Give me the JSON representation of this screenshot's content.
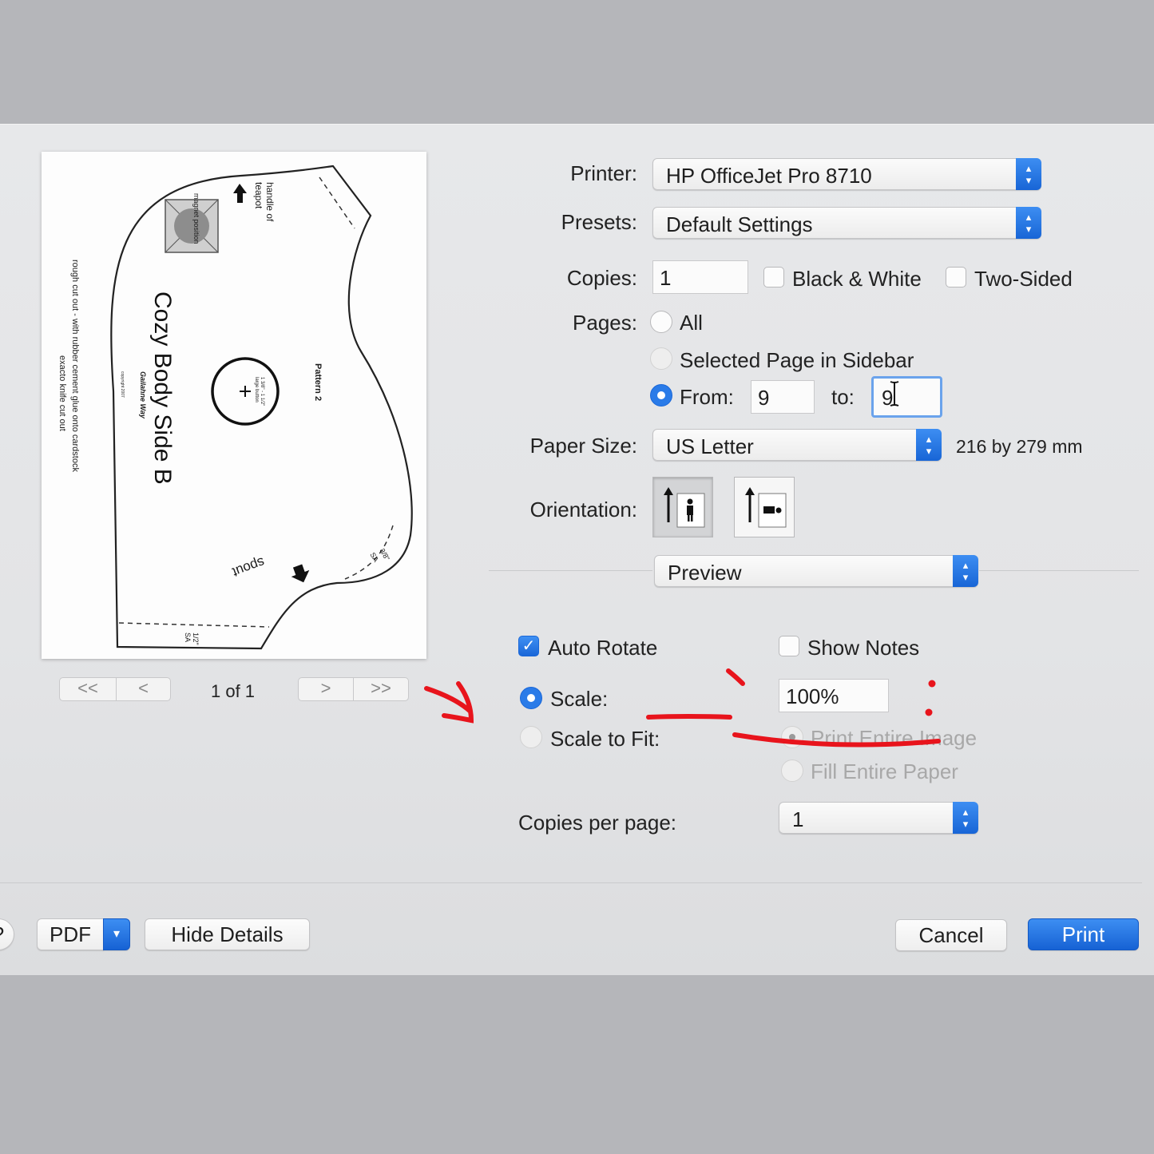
{
  "dialog": {
    "printer": {
      "label": "Printer:",
      "value": "HP OfficeJet Pro 8710"
    },
    "presets": {
      "label": "Presets:",
      "value": "Default Settings"
    },
    "copies": {
      "label": "Copies:",
      "value": "1",
      "black_white": "Black & White",
      "two_sided": "Two-Sided"
    },
    "pages": {
      "label": "Pages:",
      "all": "All",
      "selected": "Selected Page in Sidebar",
      "from_label": "From:",
      "from_value": "9",
      "to_label": "to:",
      "to_value": "9"
    },
    "paper_size": {
      "label": "Paper Size:",
      "value": "US Letter",
      "dims": "216 by 279 mm"
    },
    "orientation": {
      "label": "Orientation:"
    },
    "app_menu": {
      "value": "Preview"
    },
    "auto_rotate": "Auto Rotate",
    "show_notes": "Show Notes",
    "scale": {
      "label": "Scale:",
      "value": "100%"
    },
    "scale_to_fit": {
      "label": "Scale to Fit:",
      "print_entire": "Print Entire Image",
      "fill_entire": "Fill Entire Paper"
    },
    "copies_per_page": {
      "label": "Copies per page:",
      "value": "1"
    },
    "nav": {
      "page_indicator": "1 of 1",
      "first": "<<",
      "prev": "<",
      "next": ">",
      "last": ">>"
    },
    "footer": {
      "help": "?",
      "pdf": "PDF",
      "hide_details": "Hide Details",
      "cancel": "Cancel",
      "print": "Print"
    }
  },
  "preview_page": {
    "title": "Cozy Body Side B",
    "pattern": "Pattern 2",
    "handle": "handle of",
    "teapot": "teapot",
    "magnet": "magnet position",
    "spout": "spout",
    "button": "1 3/8\" - 1 1/2\"",
    "button2": "large button",
    "sa_left": "1/2\"",
    "sa_left2": "SA",
    "sa_right": "3/8\"",
    "sa_right2": "SA",
    "side_note1": "rough cut out - with rubber cement glue onto cardstock",
    "side_note2": "exacto knife cut out",
    "logo": "Gailahne Way",
    "copyright": "copyright 2007"
  },
  "colors": {
    "accent": "#1a67d8",
    "annotation": "#e8141c"
  }
}
